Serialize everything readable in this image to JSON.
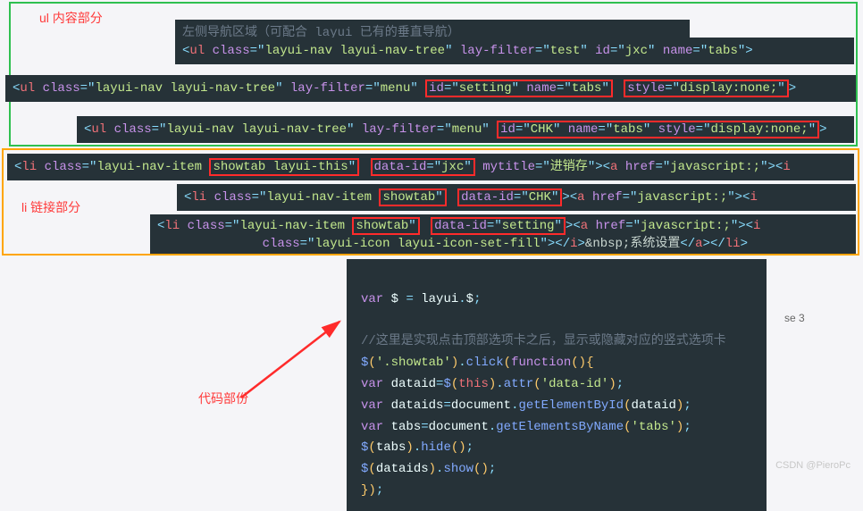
{
  "labels": {
    "ul_section": "ul 内容部分",
    "li_section": "li 链接部分",
    "code_section": "代码部份"
  },
  "strips": {
    "s0_prefix": "左侧导航区域",
    "s0_rest": "（可配合 layui 已有的垂直导航）",
    "s1_tag": "ul",
    "s1_attrs": "class=\"layui-nav layui-nav-tree\" lay-filter=\"test\" id=\"jxc\" name=\"tabs\"",
    "s2": "<ul class=\"layui-nav layui-nav-tree\" lay-filter=\"menu\" id=\"setting\" name=\"tabs\" style=\"display:none;\">",
    "s2_hl1": "id=\"setting\" name=\"tabs\"",
    "s2_hl2": "style=\"display:none;\"",
    "s3": "<ul class=\"layui-nav layui-nav-tree\" lay-filter=\"menu\" id=\"CHK\" name=\"tabs\" style=\"display:none;\">",
    "s3_hl": "id=\"CHK\" name=\"tabs\" style=\"display:none;\"",
    "s4": "<li class=\"layui-nav-item showtab layui-this\" data-id=\"jxc\" mytitle=\"进销存\"><a href=\"javascript:;\"><i",
    "s4_hl1": "showtab layui-this\"",
    "s4_hl2": "data-id=\"jxc\"",
    "s5": "<li class=\"layui-nav-item showtab\" data-id=\"CHK\"><a href=\"javascript:;\"><i",
    "s5_hl1": "showtab\"",
    "s5_hl2": "data-id=\"CHK\"",
    "s6": "<li class=\"layui-nav-item showtab\" data-id=\"setting\"><a href=\"javascript:;\"><i",
    "s6_hl1": "showtab\"",
    "s6_hl2": "data-id=\"setting\"",
    "s7": "class=\"layui-icon layui-icon-set-fill\"></i>&nbsp;系统设置</a></li>"
  },
  "code_block": {
    "line1": "var $ = layui.$;",
    "comment": "//这里是实现点击顶部选项卡之后，显示或隐藏对应的竖式选项卡",
    "line2": "$('.showtab').click(function(){",
    "line3": "var dataid=$(this).attr('data-id');",
    "line4": "var dataids=document.getElementById(dataid);",
    "line5": "var tabs=document.getElementsByName('tabs');",
    "line6": "$(tabs).hide();",
    "line7": "$(dataids).show();",
    "line8": "});"
  },
  "misc": {
    "se3": "se 3",
    "watermark": "CSDN @PieroPc"
  }
}
